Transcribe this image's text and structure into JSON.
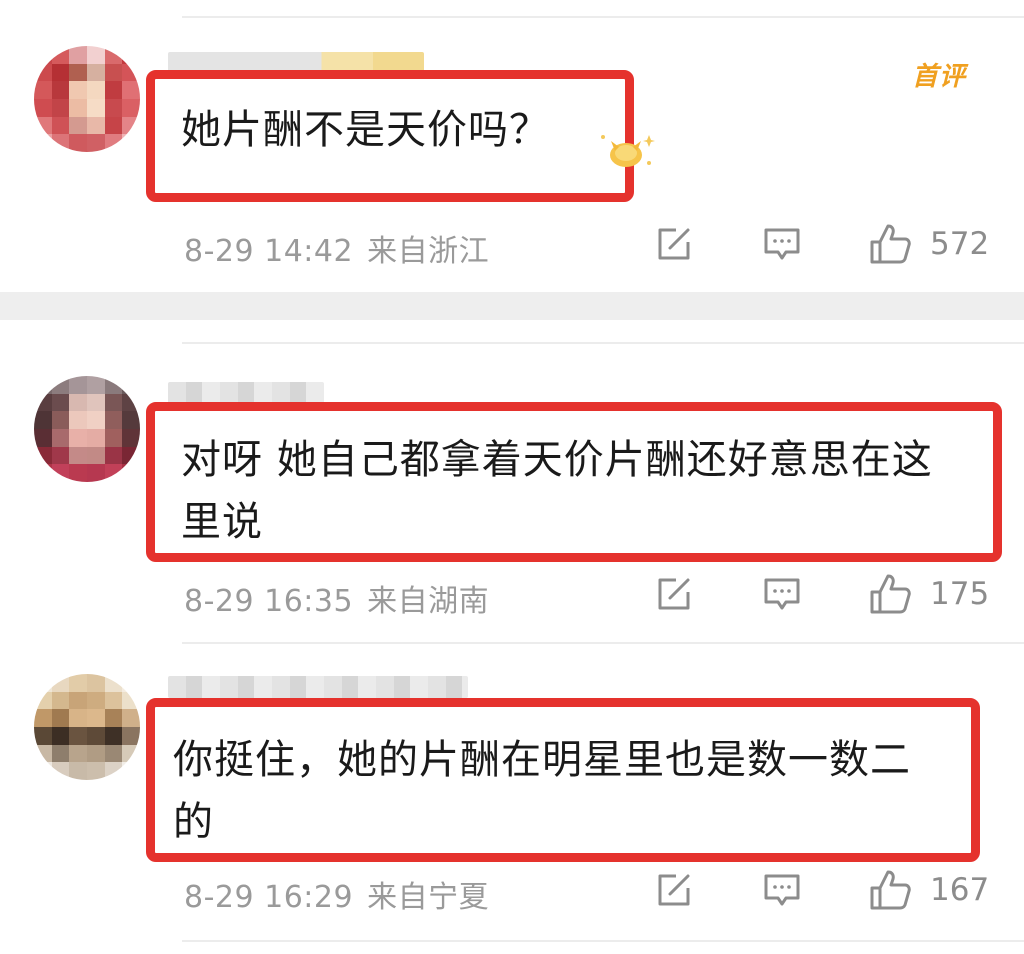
{
  "comments": [
    {
      "text": "她片酬不是天价吗？",
      "date": "8-29 14:42",
      "location": "来自浙江",
      "likes": "572",
      "tag": "首评"
    },
    {
      "text": "对呀 她自己都拿着天价片酬还好意思在这里说",
      "date": "8-29 16:35",
      "location": "来自湖南",
      "likes": "175"
    },
    {
      "text": "你挺住，她的片酬在明星里也是数一数二的",
      "date": "8-29 16:29",
      "location": "来自宁夏",
      "likes": "167"
    }
  ],
  "icons": {
    "share": "share-icon",
    "reply": "comment-icon",
    "like": "thumbs-up-icon"
  },
  "colors": {
    "highlight": "#e5322d",
    "meta": "#9a9a9a",
    "first_tag": "#f0a020"
  }
}
